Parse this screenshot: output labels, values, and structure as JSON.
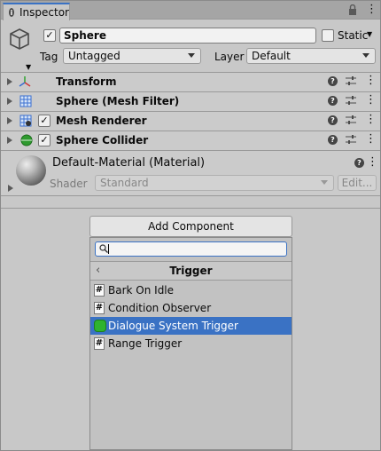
{
  "tab": {
    "title": "Inspector"
  },
  "gameobject": {
    "active": true,
    "name": "Sphere",
    "static_label": "Static",
    "static_checked": false,
    "tag_label": "Tag",
    "tag_value": "Untagged",
    "layer_label": "Layer",
    "layer_value": "Default"
  },
  "components": [
    {
      "name": "Transform",
      "icon": "transform-icon",
      "has_toggle": false
    },
    {
      "name": "Sphere (Mesh Filter)",
      "icon": "mesh-filter-icon",
      "has_toggle": false
    },
    {
      "name": "Mesh Renderer",
      "icon": "mesh-renderer-icon",
      "has_toggle": true,
      "enabled": true
    },
    {
      "name": "Sphere Collider",
      "icon": "sphere-collider-icon",
      "has_toggle": true,
      "enabled": true
    }
  ],
  "material": {
    "name": "Default-Material (Material)",
    "shader_label": "Shader",
    "shader_value": "Standard",
    "edit_label": "Edit..."
  },
  "add_component": {
    "button_label": "Add Component",
    "search_value": "",
    "category_title": "Trigger",
    "items": [
      {
        "label": "Bark On Idle",
        "icon": "script-icon",
        "selected": false
      },
      {
        "label": "Condition Observer",
        "icon": "script-icon",
        "selected": false
      },
      {
        "label": "Dialogue System Trigger",
        "icon": "dialogue-trigger-icon",
        "selected": true
      },
      {
        "label": "Range Trigger",
        "icon": "script-icon",
        "selected": false
      }
    ]
  },
  "colors": {
    "selection": "#3a72c4",
    "panel": "#c8c8c8",
    "tab_accent": "#3a72c4"
  }
}
